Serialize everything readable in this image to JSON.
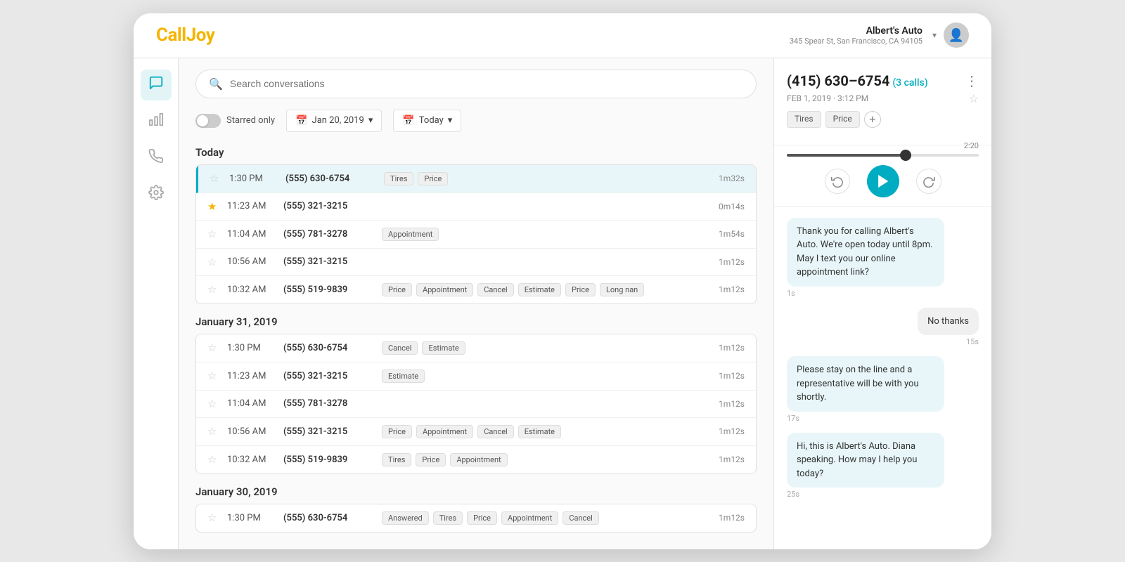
{
  "app": {
    "logo_call": "Call",
    "logo_joy": "Joy",
    "title": "CallJoy"
  },
  "topbar": {
    "business_name": "Albert's Auto",
    "business_address": "345 Spear St, San Francisco, CA 94105",
    "dropdown_label": "▾",
    "avatar_icon": "👤"
  },
  "sidebar": {
    "items": [
      {
        "id": "conversations",
        "icon": "💬",
        "active": true
      },
      {
        "id": "analytics",
        "icon": "📊",
        "active": false
      },
      {
        "id": "phone",
        "icon": "📞",
        "active": false
      },
      {
        "id": "settings",
        "icon": "⚙️",
        "active": false
      }
    ]
  },
  "search": {
    "placeholder": "Search conversations"
  },
  "filters": {
    "starred_only_label": "Starred only",
    "date_from": "Jan 20, 2019",
    "date_to": "Today"
  },
  "sections": [
    {
      "header": "Today",
      "rows": [
        {
          "time": "1:30 PM",
          "phone": "(555) 630-6754",
          "tags": [
            "Tires",
            "Price"
          ],
          "duration": "1m32s",
          "starred": false,
          "active": true
        },
        {
          "time": "11:23 AM",
          "phone": "(555) 321-3215",
          "tags": [],
          "duration": "0m14s",
          "starred": true,
          "active": false
        },
        {
          "time": "11:04 AM",
          "phone": "(555) 781-3278",
          "tags": [
            "Appointment"
          ],
          "duration": "1m54s",
          "starred": false,
          "active": false
        },
        {
          "time": "10:56 AM",
          "phone": "(555) 321-3215",
          "tags": [],
          "duration": "1m12s",
          "starred": false,
          "active": false
        },
        {
          "time": "10:32 AM",
          "phone": "(555) 519-9839",
          "tags": [
            "Price",
            "Appointment",
            "Cancel",
            "Estimate",
            "Price",
            "Long nan"
          ],
          "duration": "1m12s",
          "starred": false,
          "active": false
        }
      ]
    },
    {
      "header": "January 31, 2019",
      "rows": [
        {
          "time": "1:30 PM",
          "phone": "(555) 630-6754",
          "tags": [
            "Cancel",
            "Estimate"
          ],
          "duration": "1m12s",
          "starred": false,
          "active": false
        },
        {
          "time": "11:23 AM",
          "phone": "(555) 321-3215",
          "tags": [
            "Estimate"
          ],
          "duration": "1m12s",
          "starred": false,
          "active": false
        },
        {
          "time": "11:04 AM",
          "phone": "(555) 781-3278",
          "tags": [],
          "duration": "1m12s",
          "starred": false,
          "active": false
        },
        {
          "time": "10:56 AM",
          "phone": "(555) 321-3215",
          "tags": [
            "Price",
            "Appointment",
            "Cancel",
            "Estimate"
          ],
          "duration": "1m12s",
          "starred": false,
          "active": false
        },
        {
          "time": "10:32 AM",
          "phone": "(555) 519-9839",
          "tags": [
            "Tires",
            "Price",
            "Appointment"
          ],
          "duration": "1m12s",
          "starred": false,
          "active": false
        }
      ]
    },
    {
      "header": "January 30, 2019",
      "rows": [
        {
          "time": "1:30 PM",
          "phone": "(555) 630-6754",
          "tags": [
            "Answered",
            "Tires",
            "Price",
            "Appointment",
            "Cancel"
          ],
          "duration": "1m12s",
          "starred": false,
          "active": false
        }
      ]
    }
  ],
  "detail": {
    "phone": "(415) 630–6754",
    "calls_count": "(3 calls)",
    "date": "FEB 1, 2019 · 3:12 PM",
    "star_icon": "☆",
    "tags": [
      "Tires",
      "Price"
    ],
    "add_tag_label": "+",
    "menu_icon": "⋮",
    "progress_percent": 62,
    "duration": "2:20",
    "transcript": [
      {
        "side": "left",
        "text": "Thank you for calling Albert's Auto. We're open today until 8pm. May I text you our online appointment link?",
        "timestamp": "1s"
      },
      {
        "side": "right",
        "text": "No thanks",
        "timestamp": "15s"
      },
      {
        "side": "left",
        "text": "Please stay on the line and a representative will be with you shortly.",
        "timestamp": "17s"
      },
      {
        "side": "left",
        "text": "Hi, this is Albert's Auto. Diana speaking. How may I help you today?",
        "timestamp": "25s"
      }
    ]
  }
}
